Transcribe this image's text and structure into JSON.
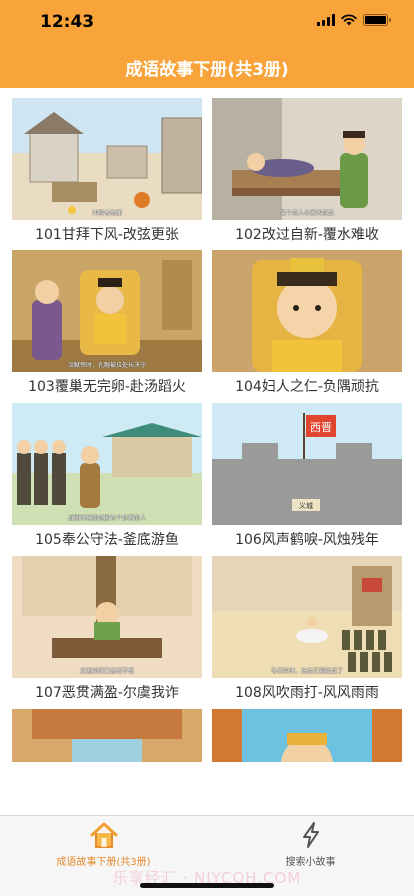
{
  "status": {
    "time": "12:43"
  },
  "nav": {
    "title": "成语故事下册(共3册)"
  },
  "stories": [
    {
      "title": "101甘拜下风-改弦更张",
      "caption": "冲智者动面"
    },
    {
      "title": "102改过自新-覆水难收",
      "caption": "某个富人小家伙赶走"
    },
    {
      "title": "103覆巢无完卵-赴汤蹈火",
      "caption": "汉献帝时，孔融被拉处长决守"
    },
    {
      "title": "104妇人之仁-负隅顽抗",
      "caption": ""
    },
    {
      "title": "105奉公守法-釜底游鱼",
      "caption": "战国时候的赵国有个赵奢的人"
    },
    {
      "title": "106风声鹤唳-风烛残年",
      "caption": ""
    },
    {
      "title": "107恶贯满盈-尔虞我诈",
      "caption": "龙池知府日思夜不眠"
    },
    {
      "title": "108风吹雨打-风风雨雨",
      "caption": "冬风吹时，先给正规接战了"
    },
    {
      "title": "",
      "caption": ""
    },
    {
      "title": "",
      "caption": ""
    }
  ],
  "scene_labels": {
    "flag_text": "西晋",
    "gate_text": "义城"
  },
  "tabs": [
    {
      "label": "成语故事下册(共3册)",
      "icon": "home-icon",
      "active": true
    },
    {
      "label": "搜索小故事",
      "icon": "lightning-icon",
      "active": false
    }
  ],
  "watermark": "乐享经汇 · NIYCOH.COM",
  "colors": {
    "header": "#f9a43a",
    "accent": "#e8892e",
    "tabbar_bg": "#f6f6f6"
  }
}
